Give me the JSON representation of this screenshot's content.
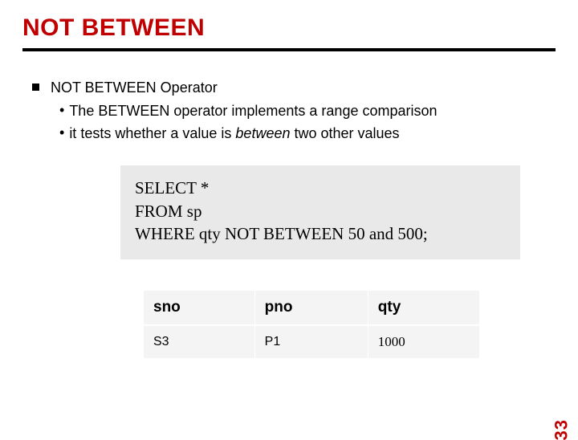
{
  "title": "NOT BETWEEN",
  "main_bullet": "NOT BETWEEN Operator",
  "sub_bullets": [
    {
      "text": "The BETWEEN operator implements a range comparison"
    },
    {
      "prefix": "it tests whether a value is ",
      "italic": "between",
      "suffix": " two other values"
    }
  ],
  "code": {
    "line1": "SELECT *",
    "line2": "FROM sp",
    "line3": "WHERE qty NOT BETWEEN 50 and 500;"
  },
  "table": {
    "headers": {
      "c1": "sno",
      "c2": "pno",
      "c3": "qty"
    },
    "rows": [
      {
        "c1": "S3",
        "c2": "P1",
        "c3": "1000"
      }
    ]
  },
  "page_number": "33"
}
